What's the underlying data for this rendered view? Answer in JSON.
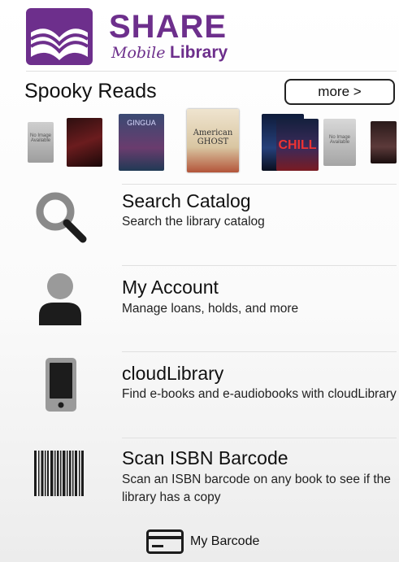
{
  "brand": {
    "name": "SHARE",
    "tagline_script": "Mobile",
    "tagline_word": "Library",
    "color": "#6d2f8c"
  },
  "carousel": {
    "title": "Spooky Reads",
    "more_label": "more >",
    "books": [
      {
        "cover_text": "No Image Available"
      },
      {
        "cover_text": ""
      },
      {
        "cover_text": "GINGUA"
      },
      {
        "cover_text": "American GHOST"
      },
      {
        "cover_text": ""
      },
      {
        "cover_text": "CHILL"
      },
      {
        "cover_text": "No Image Available"
      },
      {
        "cover_text": ""
      }
    ]
  },
  "menu": [
    {
      "id": "search",
      "icon": "magnifier-icon",
      "title": "Search Catalog",
      "subtitle": "Search the library catalog"
    },
    {
      "id": "account",
      "icon": "person-icon",
      "title": "My Account",
      "subtitle": "Manage loans, holds, and more"
    },
    {
      "id": "cloud",
      "icon": "tablet-icon",
      "title": "cloudLibrary",
      "subtitle": "Find e-books and e-audiobooks with cloudLibrary"
    },
    {
      "id": "scan",
      "icon": "barcode-icon",
      "title": "Scan ISBN Barcode",
      "subtitle": "Scan an ISBN barcode on any book to see if the library has a copy"
    }
  ],
  "footer": {
    "barcode_label": "My Barcode",
    "icon": "card-icon"
  }
}
